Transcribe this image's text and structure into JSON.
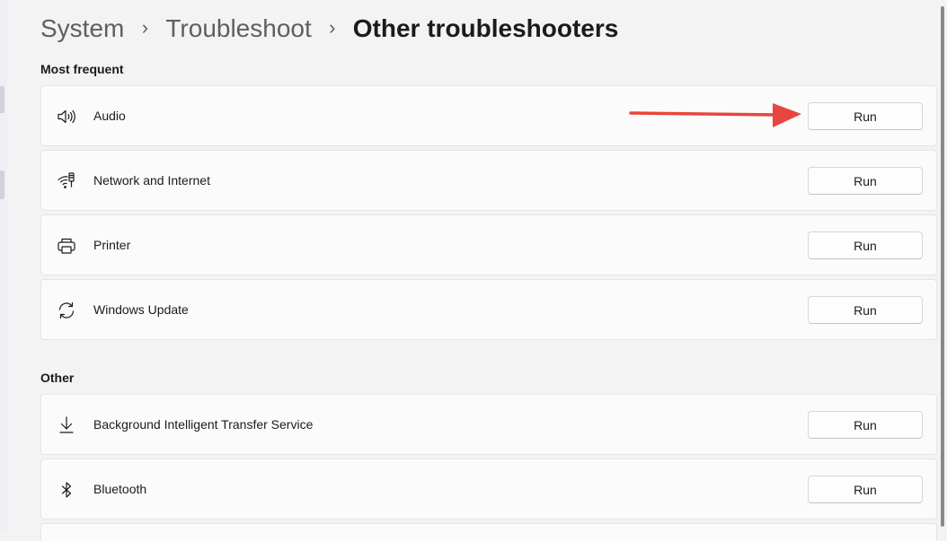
{
  "breadcrumb": {
    "items": [
      "System",
      "Troubleshoot"
    ],
    "current": "Other troubleshooters",
    "separator": "›"
  },
  "sections": {
    "most_frequent": {
      "title": "Most frequent",
      "items": [
        {
          "label": "Audio",
          "icon": "speaker-icon",
          "button": "Run"
        },
        {
          "label": "Network and Internet",
          "icon": "wifi-network-icon",
          "button": "Run"
        },
        {
          "label": "Printer",
          "icon": "printer-icon",
          "button": "Run"
        },
        {
          "label": "Windows Update",
          "icon": "sync-icon",
          "button": "Run"
        }
      ]
    },
    "other": {
      "title": "Other",
      "items": [
        {
          "label": "Background Intelligent Transfer Service",
          "icon": "download-arrow-icon",
          "button": "Run"
        },
        {
          "label": "Bluetooth",
          "icon": "bluetooth-icon",
          "button": "Run"
        }
      ]
    }
  },
  "annotation": {
    "color": "#e8453c",
    "target": "Audio Run button"
  },
  "colors": {
    "background": "#f3f3f3",
    "card": "#fbfbfb",
    "card_border": "#e5e5e5",
    "text": "#1b1b1b",
    "breadcrumb_parent": "#5f5f5f"
  }
}
